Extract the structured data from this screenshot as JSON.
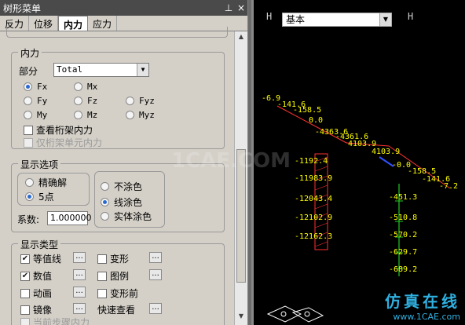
{
  "panel": {
    "title": "树形菜单",
    "pin_icon": "pin-icon",
    "close_icon": "close-icon",
    "tabs": [
      {
        "label": "反力"
      },
      {
        "label": "位移"
      },
      {
        "label": "内力",
        "active": true
      },
      {
        "label": "应力"
      }
    ]
  },
  "internal_force": {
    "group_title": "内力",
    "part_label": "部分",
    "part_value": "Total",
    "components": [
      {
        "label": "Fx",
        "selected": true
      },
      {
        "label": "Mx",
        "selected": false
      },
      {
        "label": "Fy",
        "selected": false
      },
      {
        "label": "Fz",
        "selected": false
      },
      {
        "label": "Fyz",
        "selected": false
      },
      {
        "label": "My",
        "selected": false
      },
      {
        "label": "Mz",
        "selected": false
      },
      {
        "label": "Myz",
        "selected": false
      }
    ],
    "check_truss": "查看桁架内力",
    "check_truss_only": "仅桁架单元内力"
  },
  "display_options": {
    "group_title": "显示选项",
    "precision_1": "精确解",
    "precision_2": "5点",
    "coloring_1": "不涂色",
    "coloring_2": "线涂色",
    "coloring_3": "实体涂色",
    "coef_label": "系数:",
    "coef_value": "1.000000"
  },
  "display_type": {
    "group_title": "显示类型",
    "items": [
      {
        "label": "等值线",
        "checked": true
      },
      {
        "label": "变形",
        "checked": false
      },
      {
        "label": "数值",
        "checked": true
      },
      {
        "label": "图例",
        "checked": false
      },
      {
        "label": "动画",
        "checked": false
      },
      {
        "label": "变形前",
        "checked": false
      },
      {
        "label": "镜像",
        "checked": false
      },
      {
        "label": "快速查看"
      },
      {
        "label": "当前步骤内力",
        "checked": false
      }
    ],
    "dots": "..."
  },
  "viewport": {
    "view_select": "基本",
    "left_icon": "H",
    "right_icon": "H",
    "labels_top": [
      "-6.9",
      "-141.6",
      "-158.5",
      "0.0",
      "-4363.6",
      "-4361.6",
      "4103.9",
      "4103.9",
      "-0.0",
      "-158.5",
      "-141.6",
      "-7.2"
    ],
    "labels_left_col": [
      "-1192.4",
      "-11983.9",
      "-12043.4",
      "-12102.9",
      "-12162.3"
    ],
    "labels_right_col": [
      "-451.3",
      "-510.8",
      "-570.2",
      "-629.7",
      "-689.2"
    ],
    "watermark": "1CAE.COM",
    "brand_cn": "仿真在线",
    "brand_url": "www.1CAE.com"
  }
}
